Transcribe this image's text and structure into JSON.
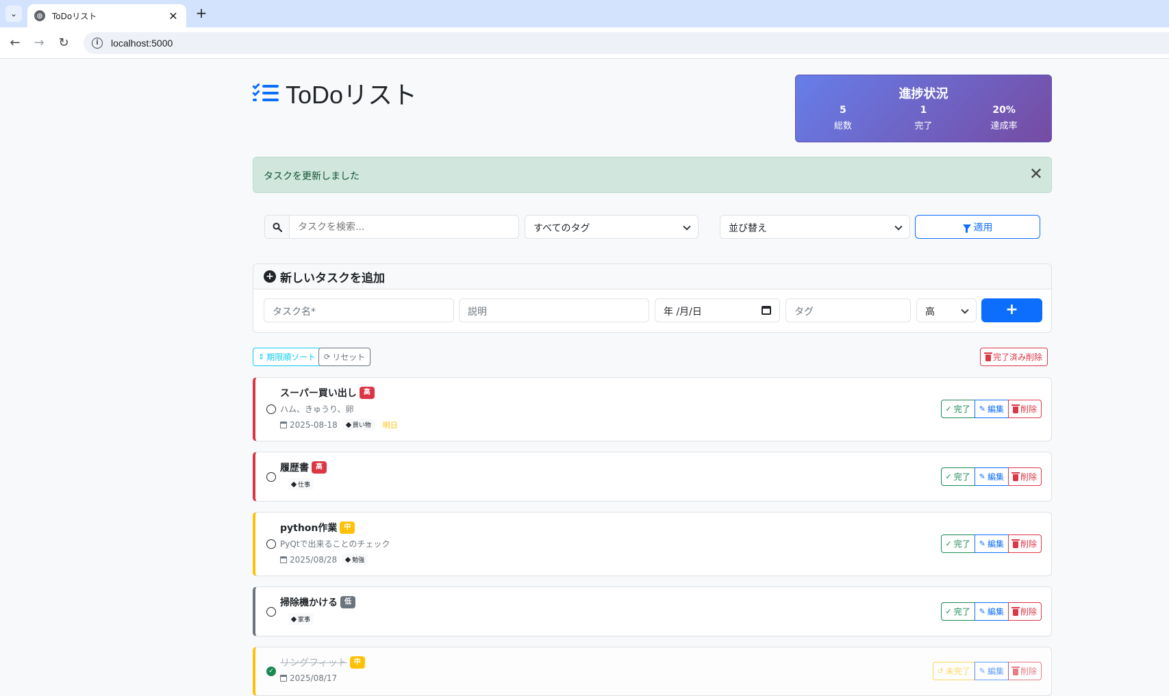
{
  "browser": {
    "tab_title": "ToDoリスト",
    "url": "localhost:5000"
  },
  "header": {
    "title": "ToDoリスト"
  },
  "progress": {
    "title": "進捗状況",
    "total_value": "5",
    "total_label": "総数",
    "done_value": "1",
    "done_label": "完了",
    "rate_value": "20%",
    "rate_label": "達成率"
  },
  "alert": {
    "message": "タスクを更新しました"
  },
  "filters": {
    "search_placeholder": "タスクを検索...",
    "tag_select": "すべてのタグ",
    "sort_select": "並び替え",
    "apply_label": "適用"
  },
  "add_form": {
    "header": "新しいタスクを追加",
    "name_placeholder": "タスク名*",
    "desc_placeholder": "説明",
    "date_placeholder": "年 /月/日",
    "tag_placeholder": "タグ",
    "priority_value": "高",
    "submit_label": "+"
  },
  "actions": {
    "sort_label": "期限順ソート",
    "reset_label": "リセット",
    "clear_label": "完了済み削除"
  },
  "task_buttons": {
    "complete": "完了",
    "undo": "未完了",
    "edit": "編集",
    "delete": "削除"
  },
  "tasks": [
    {
      "title": "スーパー買い出し",
      "priority": "高",
      "description": "ハム、きゅうり、卵",
      "due": "2025-08-18",
      "tag": "買い物",
      "due_note": "明日",
      "done": false
    },
    {
      "title": "履歴書",
      "priority": "高",
      "description": "",
      "due": "",
      "tag": "仕事",
      "due_note": "",
      "done": false
    },
    {
      "title": "python作業",
      "priority": "中",
      "description": "PyQtで出来ることのチェック",
      "due": "2025/08/28",
      "tag": "勉強",
      "due_note": "",
      "done": false
    },
    {
      "title": "掃除機かける",
      "priority": "低",
      "description": "",
      "due": "",
      "tag": "家事",
      "due_note": "",
      "done": false
    },
    {
      "title": "リングフィット",
      "priority": "中",
      "description": "",
      "due": "2025/08/17",
      "tag": "",
      "due_note": "",
      "done": true
    }
  ],
  "colors": {
    "primary": "#0d6efd",
    "success": "#198754",
    "danger": "#dc3545",
    "warning": "#ffc107",
    "secondary": "#6c757d",
    "info": "#0dcaf0"
  }
}
